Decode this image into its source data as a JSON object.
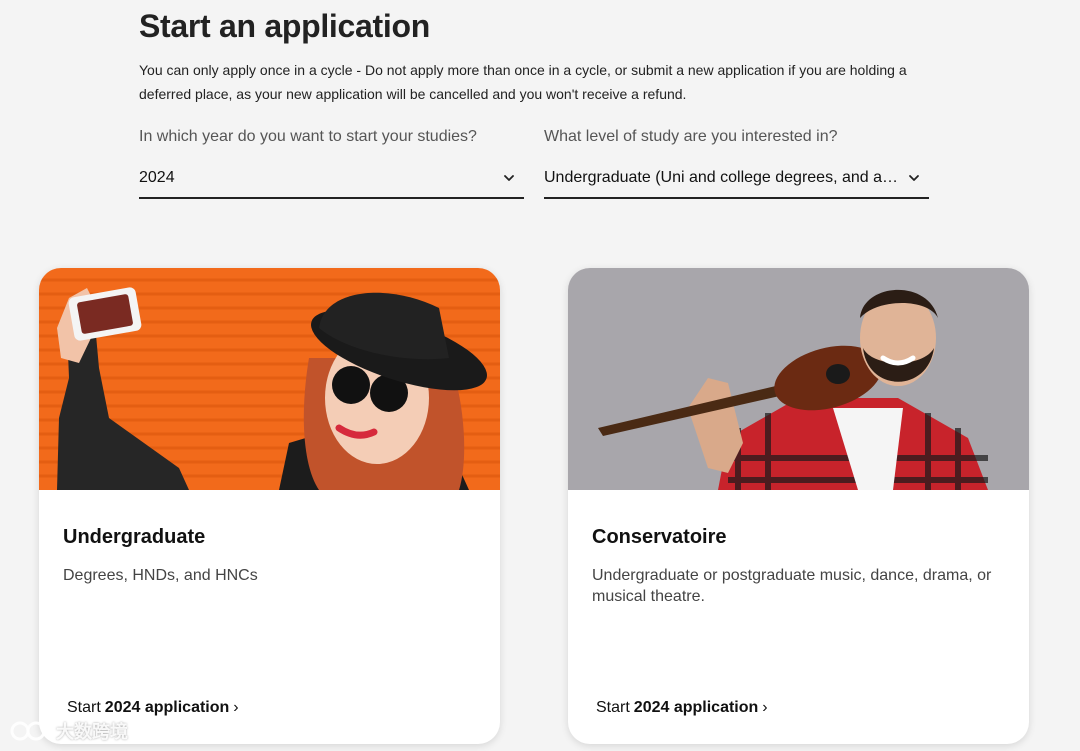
{
  "header": {
    "title": "Start an application",
    "notice": "You can only apply once in a cycle - Do not apply more than once in a cycle, or submit a new application if you are holding a deferred place, as your new application will be cancelled and you won't receive a refund."
  },
  "fields": {
    "year": {
      "label": "In which year do you want to start your studies?",
      "value": "2024"
    },
    "level": {
      "label": "What level of study are you interested in?",
      "value": "Undergraduate (Uni and college degrees, and ap…"
    }
  },
  "cards": [
    {
      "title": "Undergraduate",
      "description": "Degrees, HNDs, and HNCs",
      "link_prefix": "Start",
      "link_bold": "2024 application",
      "link_suffix": "›",
      "image_bg": "#f26a1b"
    },
    {
      "title": "Conservatoire",
      "description": "Undergraduate or postgraduate music, dance, drama, or musical theatre.",
      "link_prefix": "Start",
      "link_bold": "2024 application",
      "link_suffix": "›",
      "image_bg": "#a8a6ab"
    }
  ],
  "watermark": {
    "text": "大数跨境"
  }
}
